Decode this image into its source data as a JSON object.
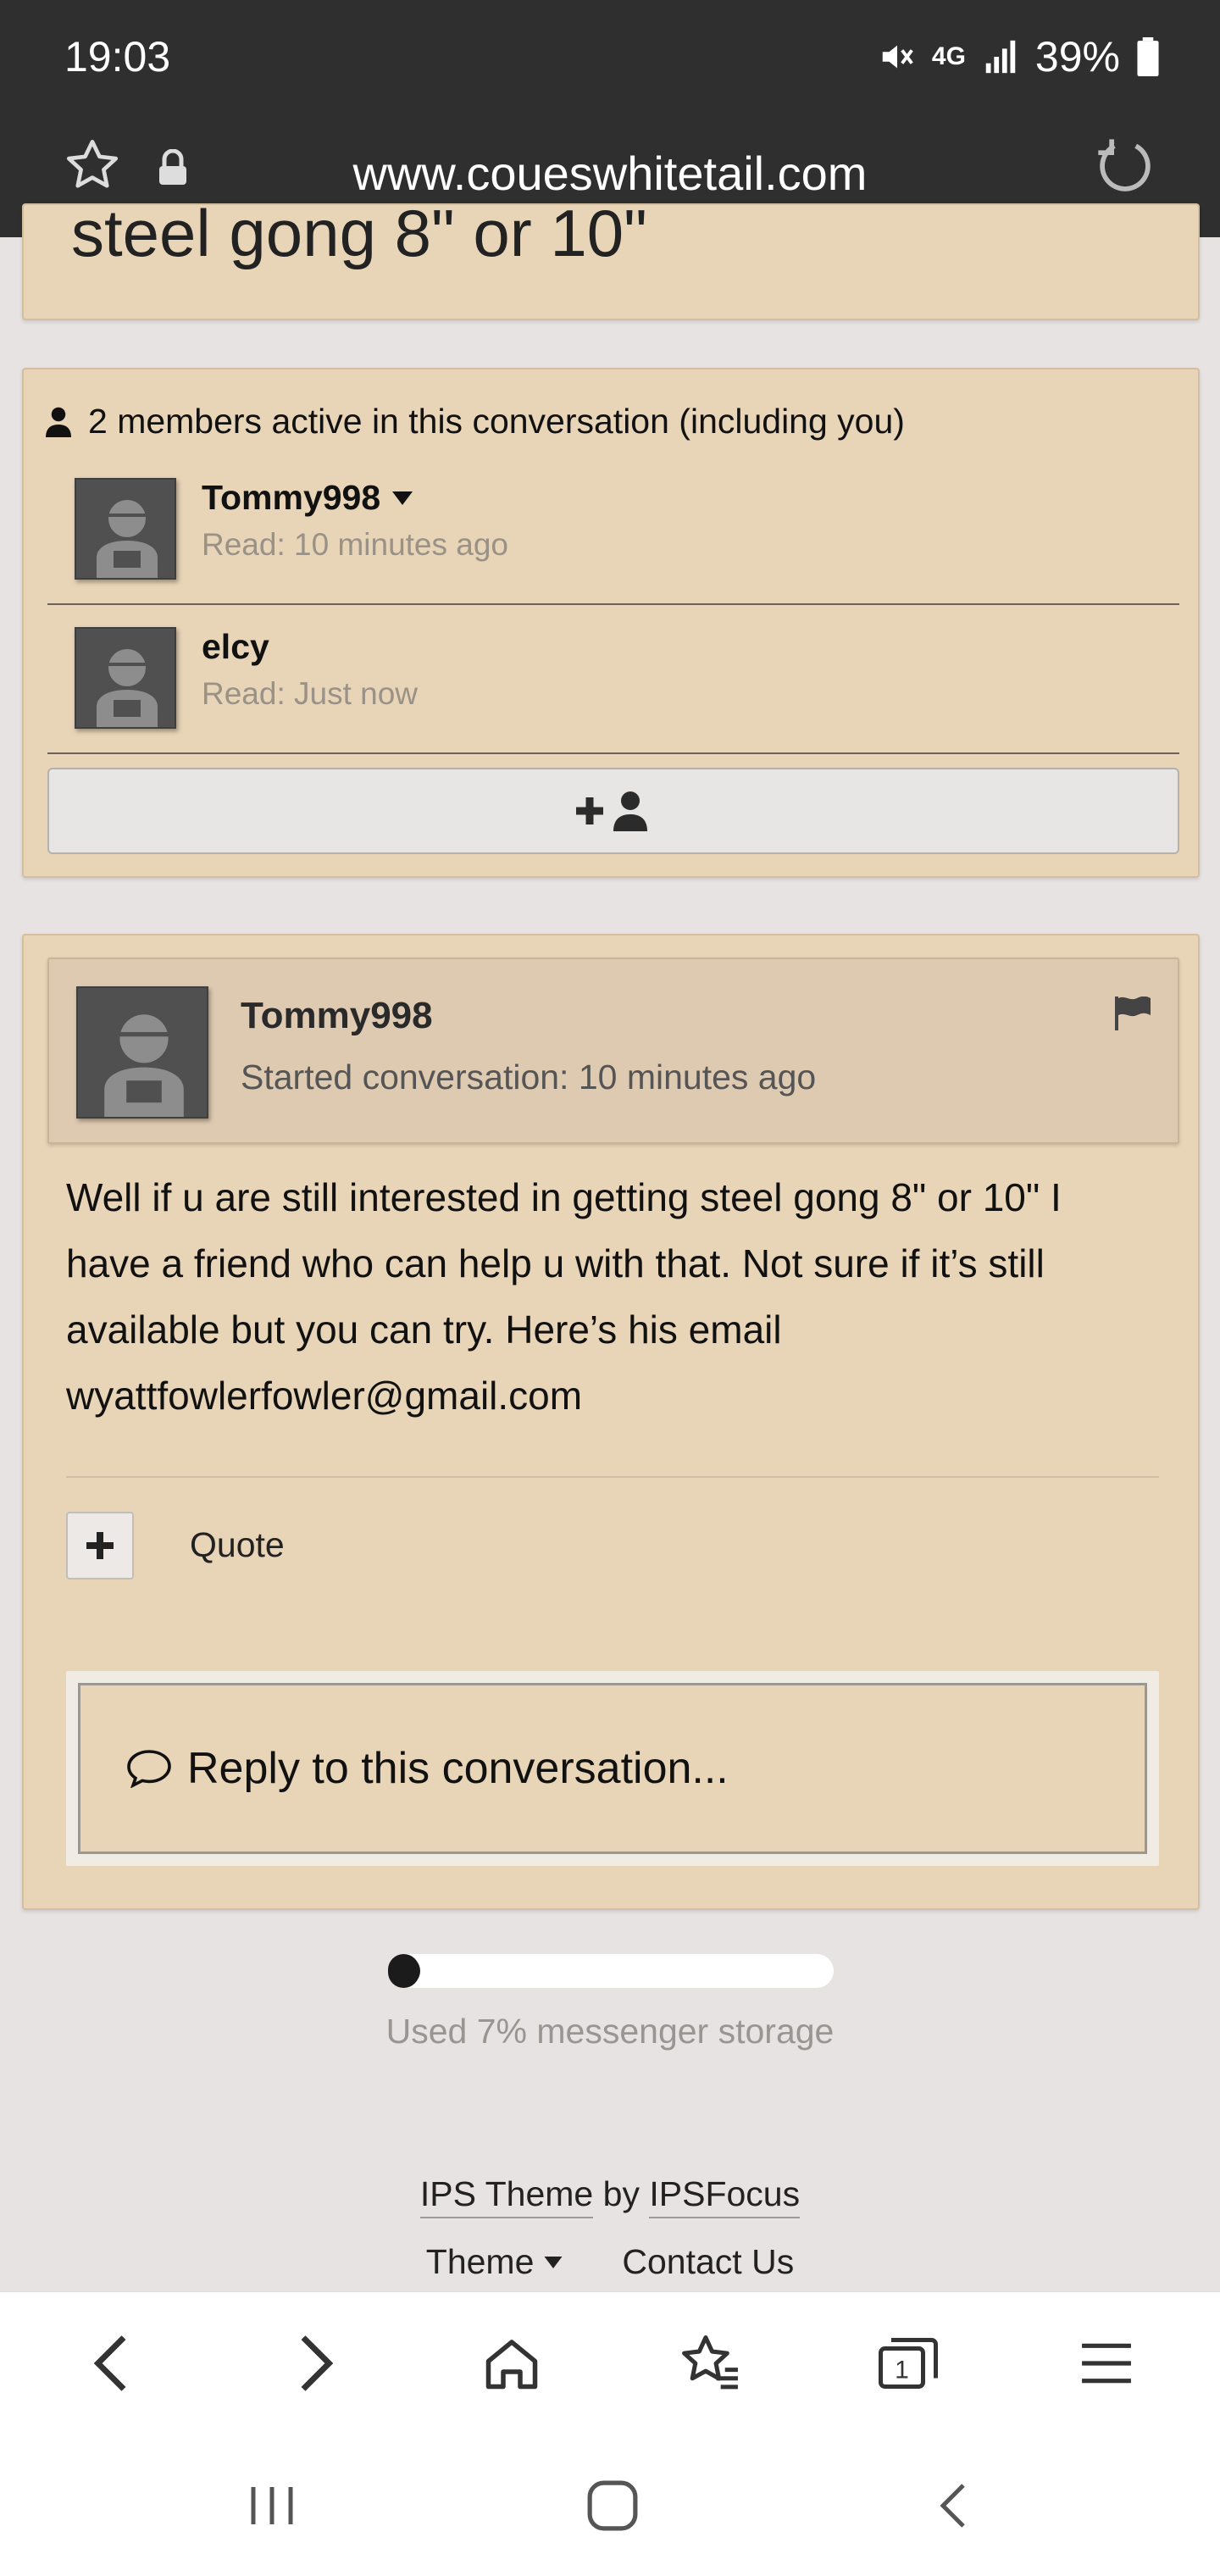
{
  "status_bar": {
    "time": "19:03",
    "network": "4G",
    "battery": "39%"
  },
  "browser": {
    "url": "www.coueswhitetail.com"
  },
  "conversation": {
    "title": "steel gong 8\" or 10\""
  },
  "members": {
    "header": "2 members active in this conversation (including you)",
    "items": [
      {
        "name": "Tommy998",
        "read": "Read: 10 minutes ago",
        "has_menu": true
      },
      {
        "name": "elcy",
        "read": "Read: Just now",
        "has_menu": false
      }
    ]
  },
  "post": {
    "author": "Tommy998",
    "meta": "Started conversation: 10 minutes ago",
    "lines": [
      "Well if u are still interested in getting steel gong 8\" or 10\" I",
      "have a friend who can help u with that. Not sure if it’s still",
      "available but you can try. Here’s his email",
      "wyattfowlerfowler@gmail.com"
    ],
    "quote_label": "Quote"
  },
  "reply": {
    "placeholder": "Reply to this conversation..."
  },
  "storage": {
    "percent": 7,
    "label": "Used 7% messenger storage"
  },
  "footer": {
    "theme_link": "IPS Theme",
    "by": "by",
    "focus_link": "IPSFocus",
    "theme_menu": "Theme",
    "contact": "Contact Us"
  },
  "colors": {
    "card_bg": "#e8d4b7",
    "page_bg": "#e7e3e2",
    "chrome_bg": "#2f2f2f"
  }
}
